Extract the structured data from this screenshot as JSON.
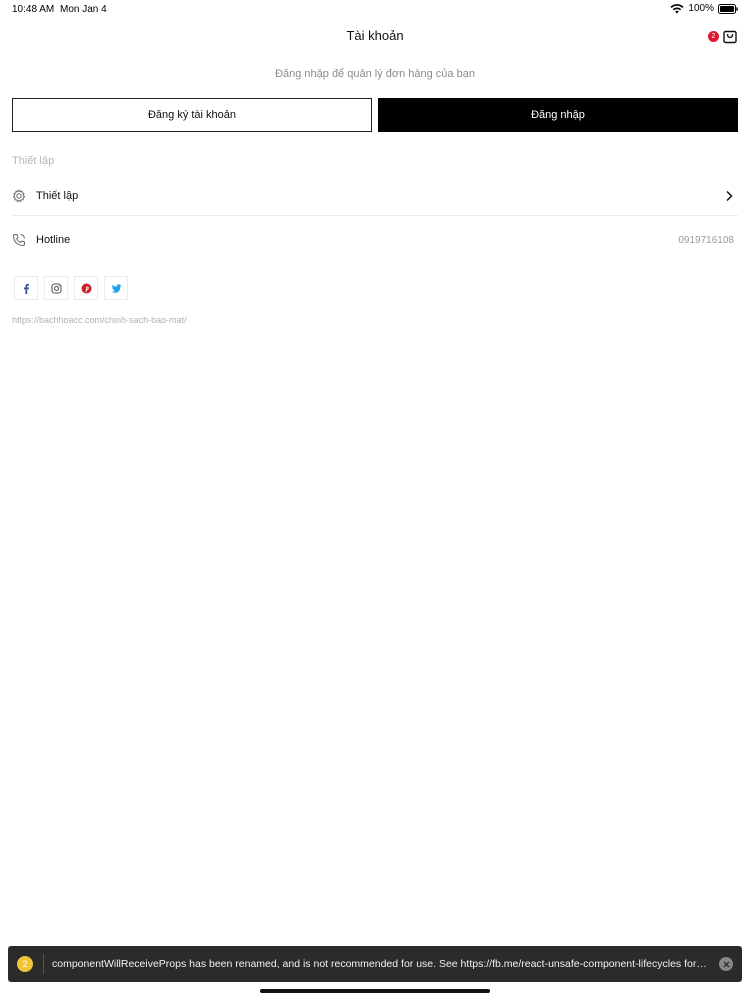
{
  "status_bar": {
    "time": "10:48 AM",
    "date": "Mon Jan 4",
    "battery": "100%",
    "icons": [
      "wifi-icon",
      "battery-icon"
    ]
  },
  "header": {
    "title": "Tài khoản",
    "cart_count": "2",
    "cart_icon": "shopping-bag-icon"
  },
  "subtitle": "Đăng nhập để quản lý đơn hàng của bạn",
  "buttons": {
    "register": "Đăng ký tài khoản",
    "login": "Đăng nhập"
  },
  "section_label": "Thiết lập",
  "menu": {
    "settings": {
      "label": "Thiết lập",
      "icon": "gear-icon"
    },
    "hotline": {
      "label": "Hotline",
      "value": "0919716108",
      "icon": "phone-icon"
    }
  },
  "social": [
    "facebook-icon",
    "instagram-icon",
    "pinterest-icon",
    "twitter-icon"
  ],
  "policy_link": "https://bachhoacc.com/chinh-sach-bao-mat/",
  "toast": {
    "count": "2",
    "message": "componentWillReceiveProps has been renamed, and is not recommended for use. See https://fb.me/react-unsafe-component-lifecycles for details."
  },
  "colors": {
    "badge": "#e0162b",
    "login_button": "#000000",
    "toast_bg": "#2b2b2b",
    "toast_count": "#f3c437",
    "facebook": "#3b5998",
    "instagram": "#555555",
    "pinterest": "#cb2027",
    "twitter": "#1da1f2"
  }
}
